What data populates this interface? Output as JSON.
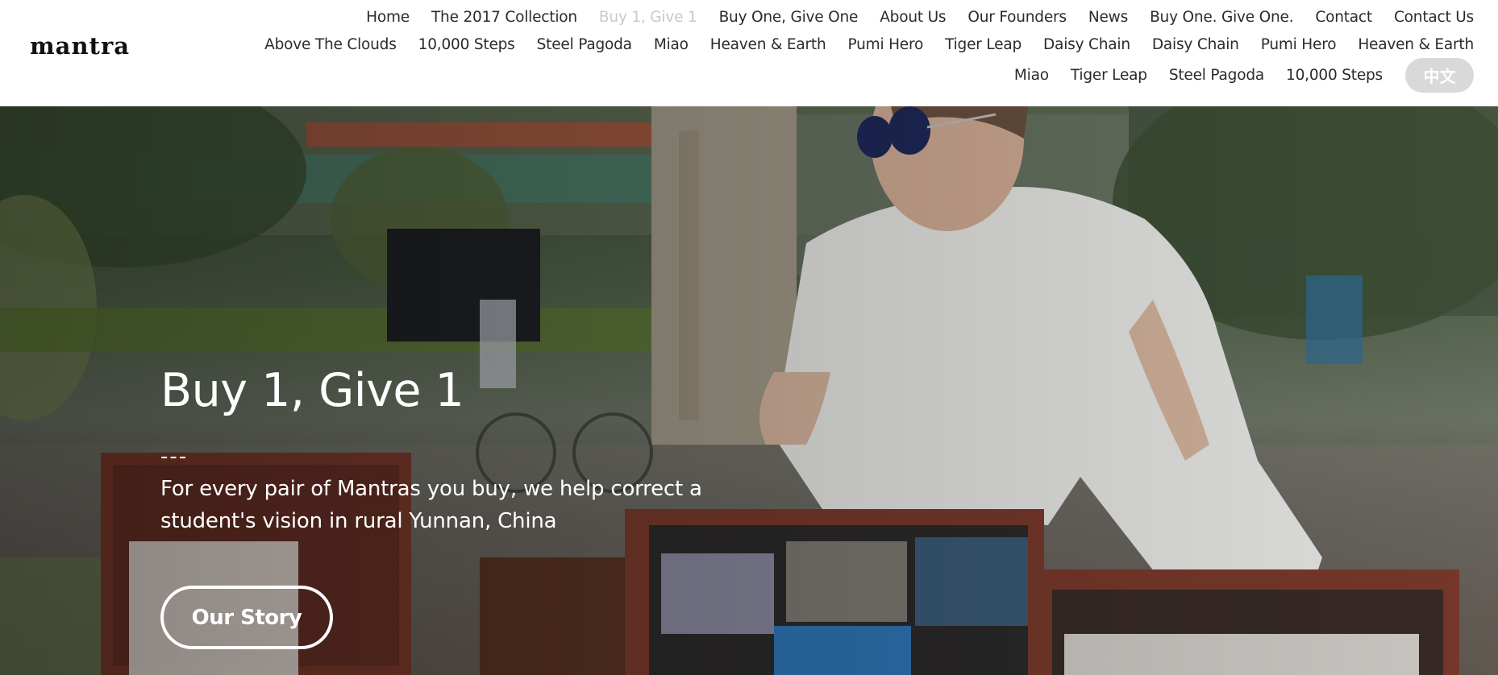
{
  "brand": {
    "logo_text": "mantra"
  },
  "nav": {
    "row1": [
      "Home",
      "The 2017 Collection",
      "Buy 1, Give 1",
      "Buy One, Give One",
      "About Us",
      "Our Founders",
      "News",
      "Buy One. Give One.",
      "Contact",
      "Contact Us"
    ],
    "row2": [
      "Above The Clouds",
      "10,000 Steps",
      "Steel Pagoda",
      "Miao",
      "Heaven & Earth",
      "Pumi Hero",
      "Tiger Leap",
      "Daisy Chain",
      "Daisy Chain",
      "Pumi Hero",
      "Heaven & Earth"
    ],
    "row3": [
      "Miao",
      "Tiger Leap",
      "Steel Pagoda",
      "10,000 Steps"
    ],
    "active": "Buy 1, Give 1",
    "language_button": "中文"
  },
  "hero": {
    "title": "Buy 1, Give 1",
    "dash": "---",
    "subtitle": "For every pair of Mantras you buy, we help correct a student's vision in rural Yunnan, China",
    "button_label": "Our Story",
    "background": "photo-man-in-white-tshirt-with-photo-suitcases"
  },
  "colors": {
    "nav_text": "#2b2b2b",
    "nav_active": "#c9c9c9",
    "lang_bg": "#d9d9d9",
    "hero_text": "#ffffff"
  }
}
